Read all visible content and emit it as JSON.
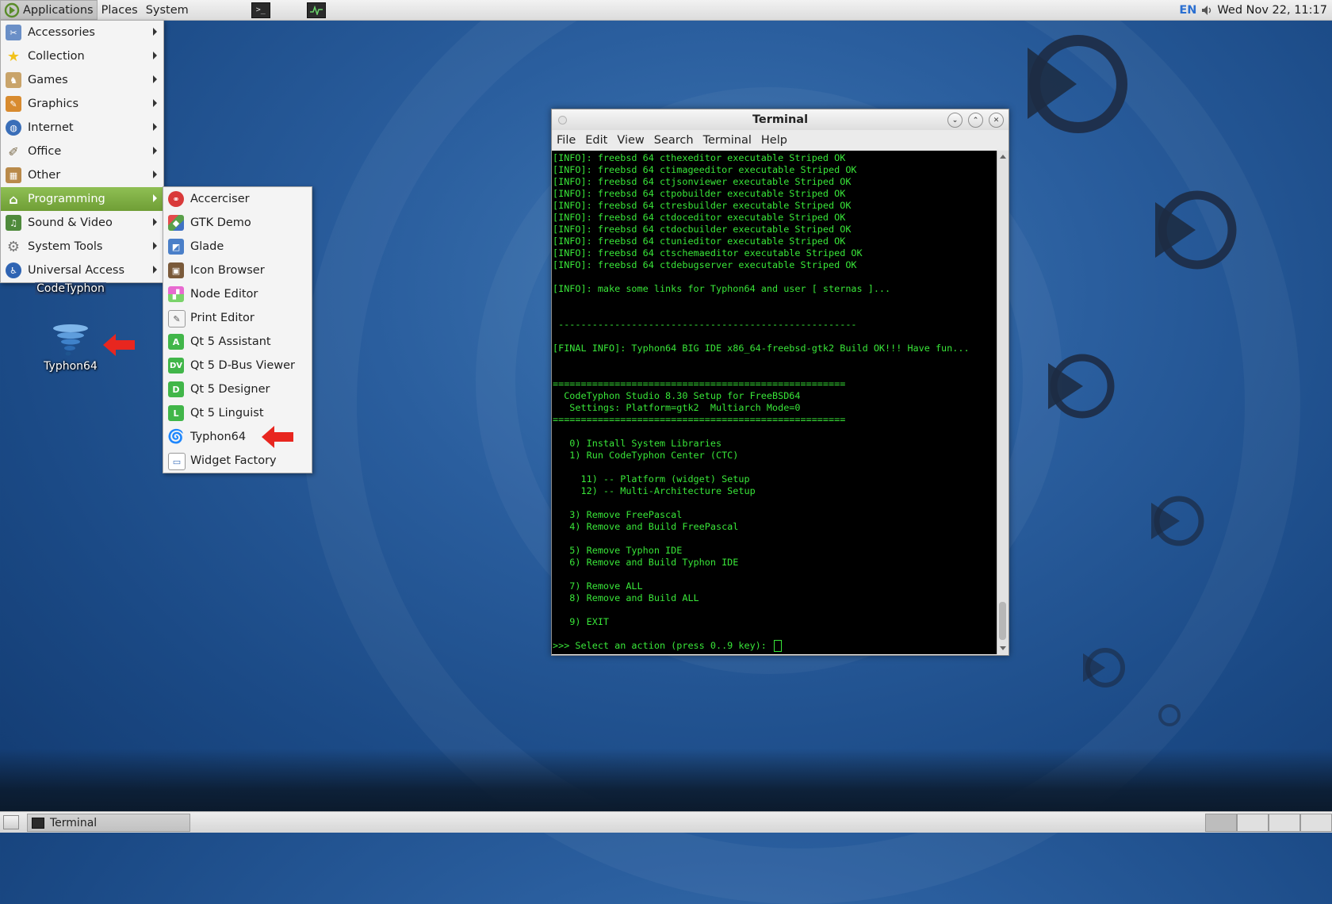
{
  "top_panel": {
    "menus": [
      "Applications",
      "Places",
      "System"
    ],
    "launchers": [
      "terminal-launcher",
      "system-monitor-launcher"
    ],
    "keyboard_layout": "EN",
    "clock": "Wed Nov 22, 11:17"
  },
  "applications_menu": {
    "items": [
      {
        "label": "Accessories",
        "icon": "accessories-icon"
      },
      {
        "label": "Collection",
        "icon": "star-icon"
      },
      {
        "label": "Games",
        "icon": "games-icon"
      },
      {
        "label": "Graphics",
        "icon": "graphics-icon"
      },
      {
        "label": "Internet",
        "icon": "globe-icon"
      },
      {
        "label": "Office",
        "icon": "office-icon"
      },
      {
        "label": "Other",
        "icon": "other-icon"
      },
      {
        "label": "Programming",
        "icon": "programming-icon",
        "highlighted": true
      },
      {
        "label": "Sound & Video",
        "icon": "sound-video-icon"
      },
      {
        "label": "System Tools",
        "icon": "system-tools-icon"
      },
      {
        "label": "Universal Access",
        "icon": "accessibility-icon"
      }
    ]
  },
  "programming_submenu": {
    "items": [
      {
        "label": "Accerciser",
        "icon": "accerciser-icon"
      },
      {
        "label": "GTK Demo",
        "icon": "gtk-demo-icon"
      },
      {
        "label": "Glade",
        "icon": "glade-icon"
      },
      {
        "label": "Icon Browser",
        "icon": "icon-browser-icon"
      },
      {
        "label": "Node Editor",
        "icon": "node-editor-icon"
      },
      {
        "label": "Print Editor",
        "icon": "print-editor-icon"
      },
      {
        "label": "Qt 5 Assistant",
        "icon": "qt-assistant-icon",
        "glyph": "A"
      },
      {
        "label": "Qt 5 D-Bus Viewer",
        "icon": "qt-dbus-viewer-icon",
        "glyph": "DV"
      },
      {
        "label": "Qt 5 Designer",
        "icon": "qt-designer-icon",
        "glyph": "D"
      },
      {
        "label": "Qt 5 Linguist",
        "icon": "qt-linguist-icon",
        "glyph": "L"
      },
      {
        "label": "Typhon64",
        "icon": "typhon64-icon"
      },
      {
        "label": "Widget Factory",
        "icon": "widget-factory-icon"
      }
    ]
  },
  "desktop": {
    "codetyphon_label": "CodeTyphon",
    "typhon64_label": "Typhon64"
  },
  "terminal": {
    "title": "Terminal",
    "menu": [
      "File",
      "Edit",
      "View",
      "Search",
      "Terminal",
      "Help"
    ],
    "output": "[INFO]: freebsd 64 cthexeditor executable Striped OK\n[INFO]: freebsd 64 ctimageeditor executable Striped OK\n[INFO]: freebsd 64 ctjsonviewer executable Striped OK\n[INFO]: freebsd 64 ctpobuilder executable Striped OK\n[INFO]: freebsd 64 ctresbuilder executable Striped OK\n[INFO]: freebsd 64 ctdoceditor executable Striped OK\n[INFO]: freebsd 64 ctdocbuilder executable Striped OK\n[INFO]: freebsd 64 ctunieditor executable Striped OK\n[INFO]: freebsd 64 ctschemaeditor executable Striped OK\n[INFO]: freebsd 64 ctdebugserver executable Striped OK\n\n[INFO]: make some links for Typhon64 and user [ sternas ]...\n\n\n -----------------------------------------------------\n\n[FINAL INFO]: Typhon64 BIG IDE x86_64-freebsd-gtk2 Build OK!!! Have fun...\n\n\n====================================================\n  CodeTyphon Studio 8.30 Setup for FreeBSD64\n   Settings: Platform=gtk2  Multiarch Mode=0\n====================================================\n\n   0) Install System Libraries\n   1) Run CodeTyphon Center (CTC)\n\n     11) -- Platform (widget) Setup\n     12) -- Multi-Architecture Setup\n\n   3) Remove FreePascal\n   4) Remove and Build FreePascal\n\n   5) Remove Typhon IDE\n   6) Remove and Build Typhon IDE\n\n   7) Remove ALL\n   8) Remove and Build ALL\n\n   9) EXIT\n\n",
    "prompt": ">>> Select an action (press 0..9 key): "
  },
  "bottom_panel": {
    "task_label": "Terminal"
  },
  "colors": {
    "terminal_text": "#39e639",
    "menu_highlight": "#7aa83f",
    "arrow_red": "#e8261f"
  }
}
